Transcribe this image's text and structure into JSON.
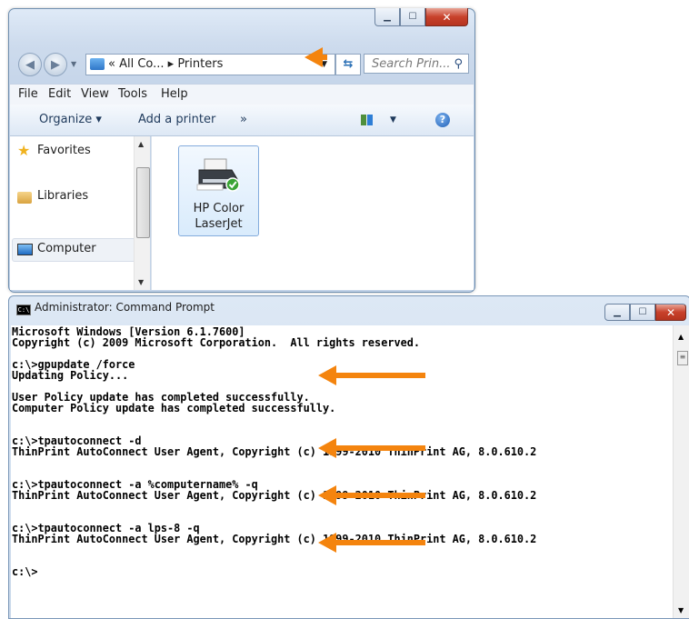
{
  "explorer": {
    "address": "« All Co... ▸ Printers",
    "search_placeholder": "Search Prin...",
    "menu": [
      "File",
      "Edit",
      "View",
      "Tools",
      "Help"
    ],
    "toolbar": {
      "organize": "Organize ▾",
      "add_printer": "Add a printer",
      "more": "»"
    },
    "nav": {
      "favorites": "Favorites",
      "libraries": "Libraries",
      "computer": "Computer"
    },
    "printer": {
      "line1": "HP Color",
      "line2": "LaserJet"
    }
  },
  "console": {
    "title": "Administrator: Command Prompt",
    "icon_text": "C:\\",
    "lines": "Microsoft Windows [Version 6.1.7600]\nCopyright (c) 2009 Microsoft Corporation.  All rights reserved.\n\nc:\\>gpupdate /force\nUpdating Policy...\n\nUser Policy update has completed successfully.\nComputer Policy update has completed successfully.\n\n\nc:\\>tpautoconnect -d\nThinPrint AutoConnect User Agent, Copyright (c) 1999-2010 ThinPrint AG, 8.0.610.2\n\n\nc:\\>tpautoconnect -a %computername% -q\nThinPrint AutoConnect User Agent, Copyright (c) 1999-2010 ThinPrint AG, 8.0.610.2\n\n\nc:\\>tpautoconnect -a lps-8 -q\nThinPrint AutoConnect User Agent, Copyright (c) 1999-2010 ThinPrint AG, 8.0.610.2\n\n\nc:\\>"
  },
  "colors": {
    "arrow": "#f4840e",
    "close": "#c8412b"
  }
}
